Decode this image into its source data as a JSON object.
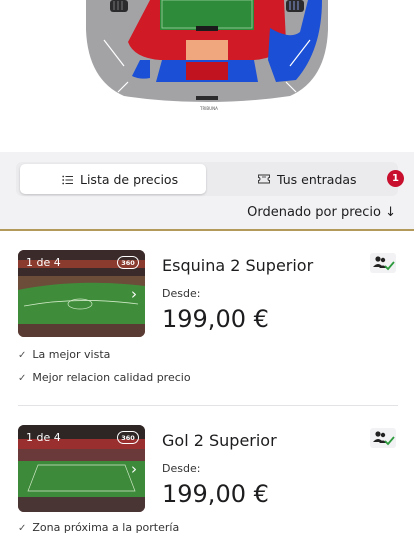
{
  "stadium_map": {
    "gate_bottom_label": "TRIBUNA",
    "colors": {
      "grey": "#9b9b9d",
      "red": "#d01a26",
      "blue": "#1a4fd6",
      "pitch": "#2e8b3a",
      "orange": "#f0a77e",
      "dark": "#2b2b2e"
    }
  },
  "tabs": {
    "price_list": {
      "label": "Lista de precios",
      "icon": "list-icon"
    },
    "your_tickets": {
      "label": "Tus entradas",
      "icon": "ticket-icon",
      "badge": "1"
    }
  },
  "sort": {
    "label": "Ordenado por precio ↓"
  },
  "accent_color": "#b49a5a",
  "badge_color": "#c8102e",
  "cards": [
    {
      "image_counter": "1 de 4",
      "badge_360": "360",
      "title": "Esquina 2 Superior",
      "from_label": "Desde:",
      "price": "199,00 €",
      "icon": "group-check-icon",
      "features": [
        "La mejor vista",
        "Mejor relacion calidad precio"
      ]
    },
    {
      "image_counter": "1 de 4",
      "badge_360": "360",
      "title": "Gol 2 Superior",
      "from_label": "Desde:",
      "price": "199,00 €",
      "icon": "group-check-icon",
      "features": [
        "Zona próxima a la portería"
      ]
    }
  ]
}
